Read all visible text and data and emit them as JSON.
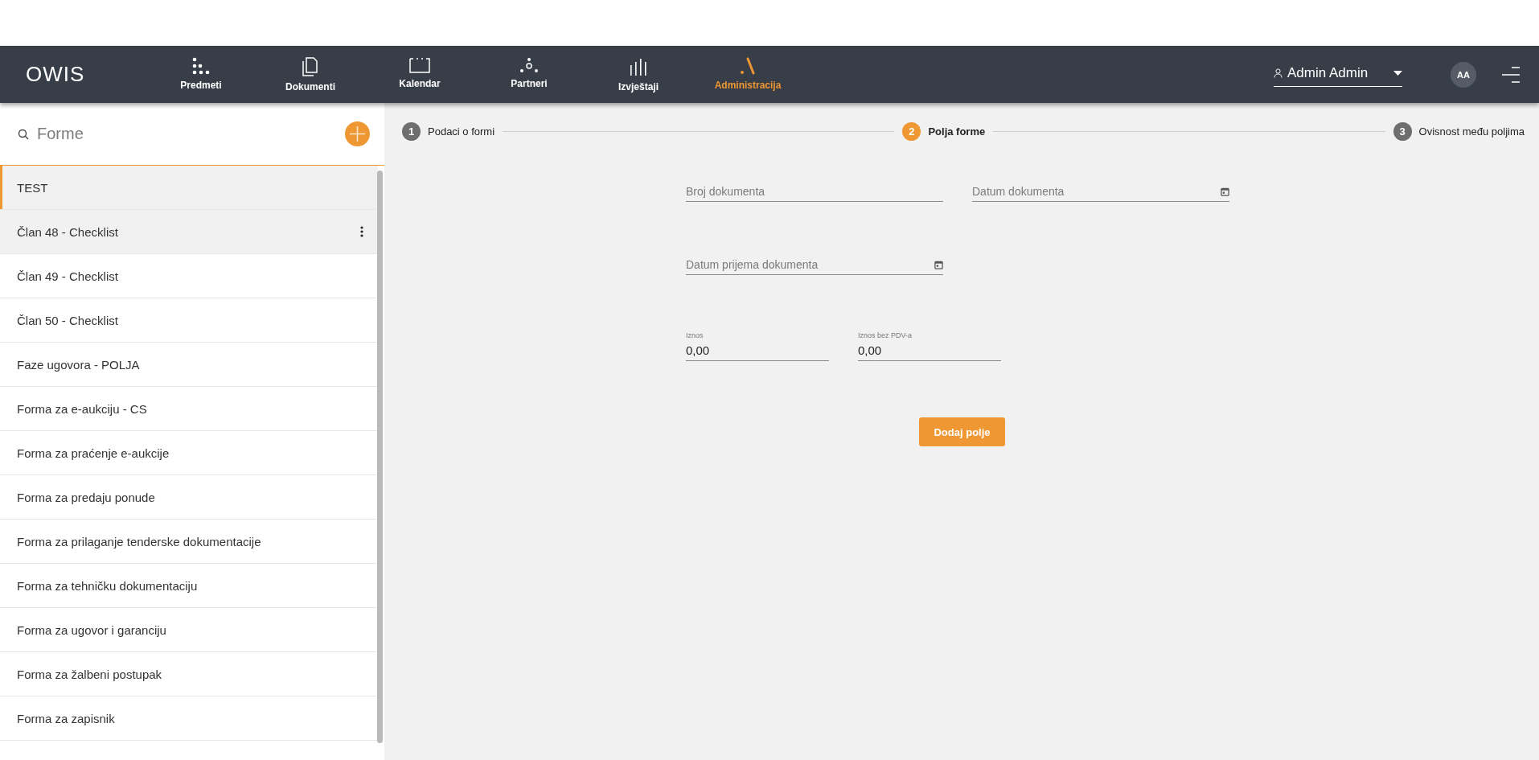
{
  "header": {
    "logo": "OWIS",
    "nav": [
      {
        "label": "Predmeti",
        "selected": false
      },
      {
        "label": "Dokumenti",
        "selected": false
      },
      {
        "label": "Kalendar",
        "selected": false
      },
      {
        "label": "Partneri",
        "selected": false
      },
      {
        "label": "Izvještaji",
        "selected": false
      },
      {
        "label": "Administracija",
        "selected": true
      }
    ],
    "user": "Admin Admin",
    "avatar": "AA"
  },
  "sidebar": {
    "search_placeholder": "Forme",
    "items": [
      {
        "label": "TEST",
        "selected": true,
        "highlighted": false
      },
      {
        "label": "Član 48 - Checklist",
        "selected": false,
        "highlighted": true
      },
      {
        "label": "Član 49 - Checklist",
        "selected": false,
        "highlighted": false
      },
      {
        "label": "Član 50 - Checklist",
        "selected": false,
        "highlighted": false
      },
      {
        "label": "Faze ugovora - POLJA",
        "selected": false,
        "highlighted": false
      },
      {
        "label": "Forma za e-aukciju - CS",
        "selected": false,
        "highlighted": false
      },
      {
        "label": "Forma za praćenje e-aukcije",
        "selected": false,
        "highlighted": false
      },
      {
        "label": "Forma za predaju ponude",
        "selected": false,
        "highlighted": false
      },
      {
        "label": "Forma za prilaganje tenderske dokumentacije",
        "selected": false,
        "highlighted": false
      },
      {
        "label": "Forma za tehničku dokumentaciju",
        "selected": false,
        "highlighted": false
      },
      {
        "label": "Forma za ugovor i garanciju",
        "selected": false,
        "highlighted": false
      },
      {
        "label": "Forma za žalbeni postupak",
        "selected": false,
        "highlighted": false
      },
      {
        "label": "Forma za zapisnik",
        "selected": false,
        "highlighted": false
      }
    ]
  },
  "stepper": [
    {
      "number": "1",
      "label": "Podaci o formi",
      "selected": false
    },
    {
      "number": "2",
      "label": "Polja forme",
      "selected": true
    },
    {
      "number": "3",
      "label": "Ovisnost među poljima",
      "selected": false
    }
  ],
  "form": {
    "rows": [
      [
        {
          "kind": "text",
          "placeholder": "Broj dokumenta"
        },
        {
          "kind": "date",
          "placeholder": "Datum dokumenta"
        }
      ],
      [
        {
          "kind": "date",
          "placeholder": "Datum prijema dokumenta"
        }
      ],
      [
        {
          "kind": "number",
          "label": "Iznos",
          "value": "0,00"
        },
        {
          "kind": "number",
          "label": "Iznos bez PDV-a",
          "value": "0,00"
        }
      ]
    ],
    "add_button": "Dodaj polje"
  }
}
